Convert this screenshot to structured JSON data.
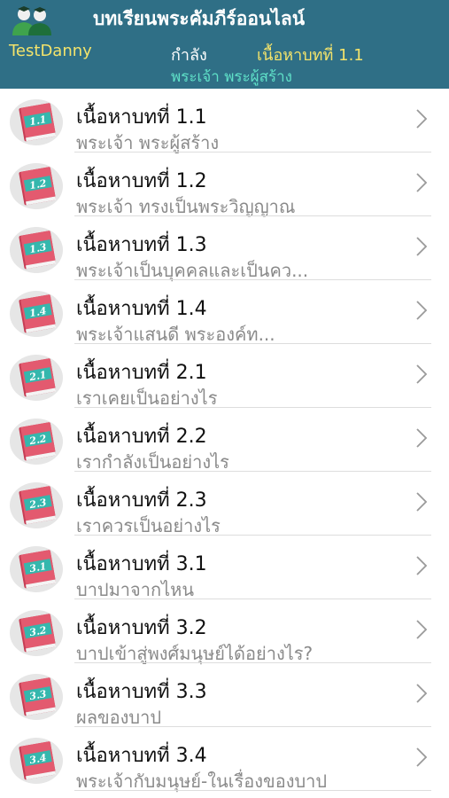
{
  "header": {
    "app_title": "บทเรียนพระคัมภีร์ออนไลน์",
    "user_name": "TestDanny",
    "status_label": "กำลัง",
    "current_lesson": "เนื้อหาบทที่ 1.1",
    "current_topic": "พระเจ้า พระผู้สร้าง",
    "logo_icon": "two-people-icon"
  },
  "colors": {
    "header_bg": "#2f6f86",
    "accent_yellow": "#f3e36b",
    "accent_teal": "#5fe0c8",
    "book_cover": "#e35a6f",
    "book_label": "#35b7ad"
  },
  "lessons": [
    {
      "badge": "1.1",
      "title": "เนื้อหาบทที่ 1.1",
      "subtitle": "พระเจ้า พระผู้สร้าง"
    },
    {
      "badge": "1.2",
      "title": "เนื้อหาบทที่ 1.2",
      "subtitle": "พระเจ้า ทรงเป็นพระวิญญาณ"
    },
    {
      "badge": "1.3",
      "title": "เนื้อหาบทที่ 1.3",
      "subtitle": "พระเจ้าเป็นบุคคลและเป็นคว..."
    },
    {
      "badge": "1.4",
      "title": "เนื้อหาบทที่ 1.4",
      "subtitle": "พระเจ้าแสนดี พระองค์ท..."
    },
    {
      "badge": "2.1",
      "title": "เนื้อหาบทที่ 2.1",
      "subtitle": "เราเคยเป็นอย่างไร"
    },
    {
      "badge": "2.2",
      "title": "เนื้อหาบทที่ 2.2",
      "subtitle": "เรากำลังเป็นอย่างไร"
    },
    {
      "badge": "2.3",
      "title": "เนื้อหาบทที่ 2.3",
      "subtitle": "เราควรเป็นอย่างไร"
    },
    {
      "badge": "3.1",
      "title": "เนื้อหาบทที่ 3.1",
      "subtitle": "บาปมาจากไหน"
    },
    {
      "badge": "3.2",
      "title": "เนื้อหาบทที่ 3.2",
      "subtitle": "บาปเข้าสู่พงศ์มนุษย์ได้อย่างไร?"
    },
    {
      "badge": "3.3",
      "title": "เนื้อหาบทที่ 3.3",
      "subtitle": "ผลของบาป"
    },
    {
      "badge": "3.4",
      "title": "เนื้อหาบทที่ 3.4",
      "subtitle": "พระเจ้ากับมนุษย์-ในเรื่องของบาป"
    }
  ]
}
